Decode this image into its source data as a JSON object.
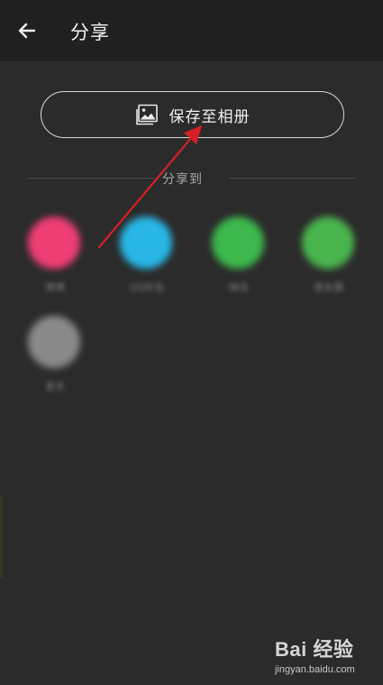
{
  "app_bar": {
    "back_icon": "arrow-left-icon",
    "title": "分享"
  },
  "save_button": {
    "icon": "image-icon",
    "label": "保存至相册"
  },
  "share_section": {
    "heading": "分享到",
    "items": [
      {
        "name": "微博",
        "color": "#ee3e73"
      },
      {
        "name": "QQ好友",
        "color": "#27b6e6"
      },
      {
        "name": "微信",
        "color": "#3cb84c"
      },
      {
        "name": "朋友圈",
        "color": "#49b54d"
      },
      {
        "name": "更多",
        "color": "#8a8a8a"
      }
    ]
  },
  "annotation": {
    "color": "#d52025"
  },
  "watermark": {
    "logo": "Bai 经验",
    "url": "jingyan.baidu.com"
  }
}
